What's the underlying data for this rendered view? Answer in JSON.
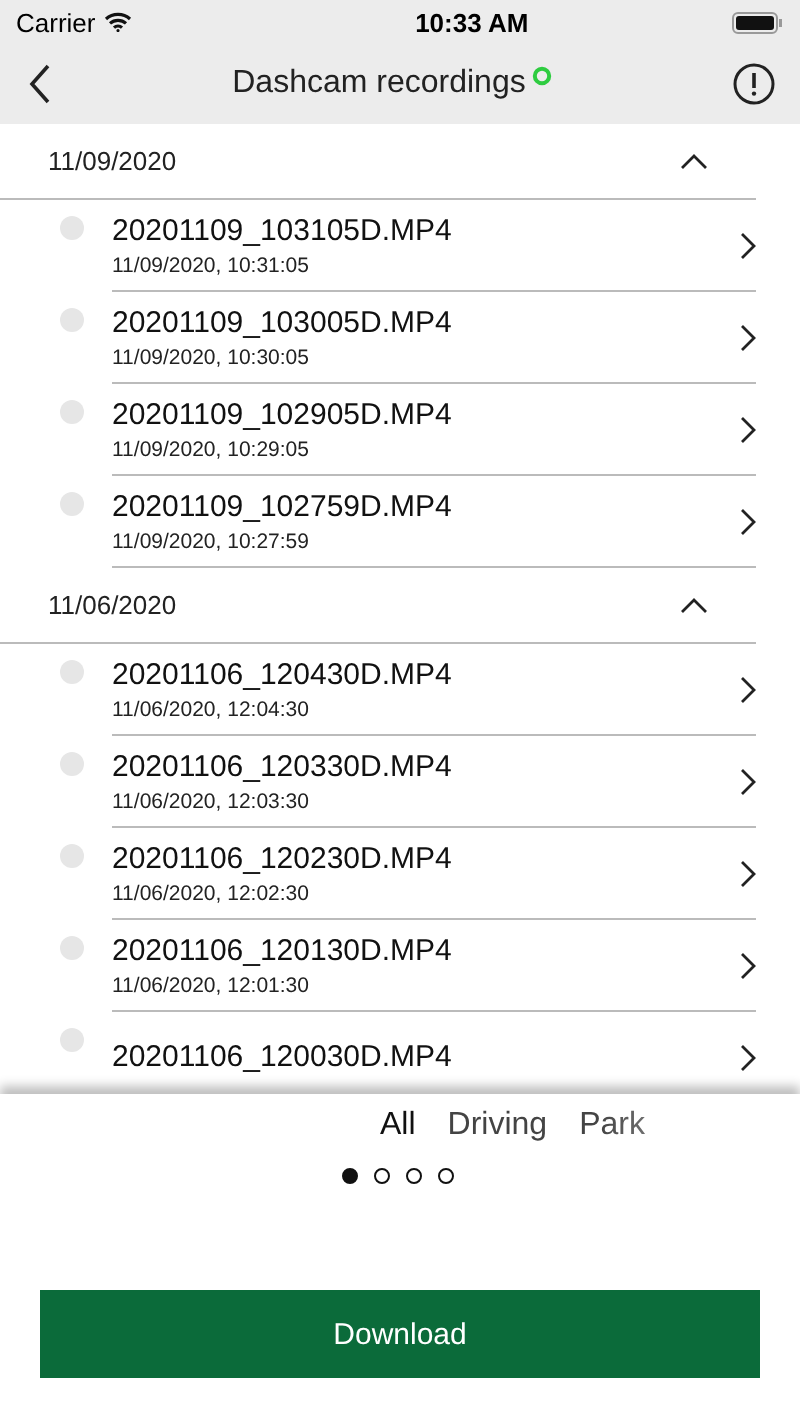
{
  "status_bar": {
    "carrier": "Carrier",
    "time": "10:33 AM"
  },
  "nav": {
    "title": "Dashcam recordings",
    "connected": true
  },
  "sections": [
    {
      "date": "11/09/2020",
      "expanded": true,
      "items": [
        {
          "file": "20201109_103105D.MP4",
          "time": "11/09/2020, 10:31:05",
          "selected": false
        },
        {
          "file": "20201109_103005D.MP4",
          "time": "11/09/2020, 10:30:05",
          "selected": false
        },
        {
          "file": "20201109_102905D.MP4",
          "time": "11/09/2020, 10:29:05",
          "selected": false
        },
        {
          "file": "20201109_102759D.MP4",
          "time": "11/09/2020, 10:27:59",
          "selected": false
        }
      ]
    },
    {
      "date": "11/06/2020",
      "expanded": true,
      "items": [
        {
          "file": "20201106_120430D.MP4",
          "time": "11/06/2020, 12:04:30",
          "selected": false
        },
        {
          "file": "20201106_120330D.MP4",
          "time": "11/06/2020, 12:03:30",
          "selected": false
        },
        {
          "file": "20201106_120230D.MP4",
          "time": "11/06/2020, 12:02:30",
          "selected": false
        },
        {
          "file": "20201106_120130D.MP4",
          "time": "11/06/2020, 12:01:30",
          "selected": false
        },
        {
          "file": "20201106_120030D.MP4",
          "selected": false
        }
      ]
    }
  ],
  "filters": [
    {
      "label": "All",
      "selected": true
    },
    {
      "label": "Driving",
      "selected": false
    },
    {
      "label": "Park",
      "selected": false
    }
  ],
  "pages": [
    {
      "selected": true
    },
    {
      "selected": false
    },
    {
      "selected": false
    },
    {
      "selected": false
    }
  ],
  "download_button": "Download"
}
